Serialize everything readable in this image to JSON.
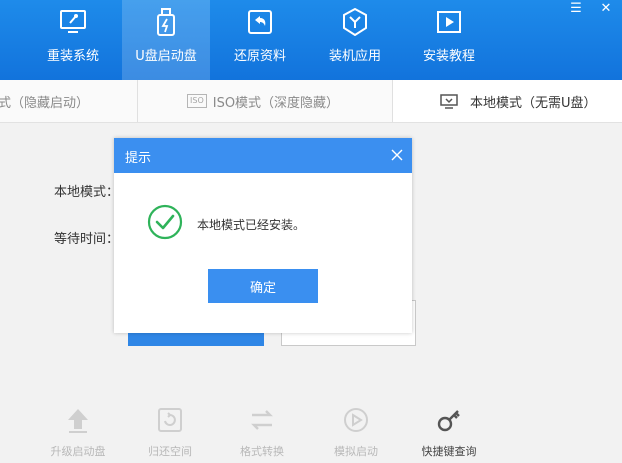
{
  "colors": {
    "header_blue": "#1273dc",
    "dialog_blue": "#3b8ff0",
    "success_green": "#2fb35a"
  },
  "nav": {
    "items": [
      {
        "label": "重装系统",
        "icon": "monitor-wrench-icon"
      },
      {
        "label": "U盘启动盘",
        "icon": "usb-drive-icon"
      },
      {
        "label": "还原资料",
        "icon": "restore-icon"
      },
      {
        "label": "装机应用",
        "icon": "shield-app-icon"
      },
      {
        "label": "安装教程",
        "icon": "video-tutorial-icon"
      }
    ],
    "active_index": 1
  },
  "window_controls": {
    "menu_icon": "menu-icon",
    "close_icon": "close-icon"
  },
  "tabs": [
    {
      "label": "式（隐藏启动）"
    },
    {
      "label": "ISO模式（深度隐藏）",
      "badge": "ISO"
    },
    {
      "label": "本地模式（无需U盘）",
      "icon": "monitor-download-icon"
    }
  ],
  "main": {
    "local_mode_label": "本地模式：",
    "wait_time_label": "等待时间："
  },
  "tools": [
    {
      "label": "升级启动盘",
      "icon": "upload-arrow-icon"
    },
    {
      "label": "归还空间",
      "icon": "reclaim-space-icon"
    },
    {
      "label": "格式转换",
      "icon": "convert-arrows-icon"
    },
    {
      "label": "模拟启动",
      "icon": "play-circle-icon"
    },
    {
      "label": "快捷键查询",
      "icon": "key-icon"
    }
  ],
  "dialog": {
    "title": "提示",
    "message": "本地模式已经安装。",
    "ok_label": "确定"
  }
}
